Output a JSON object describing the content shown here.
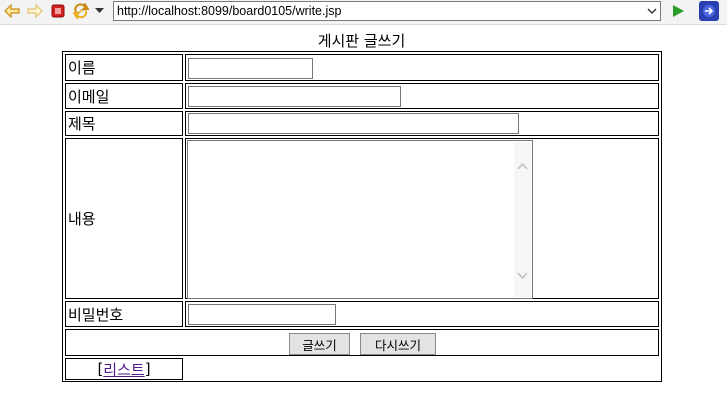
{
  "toolbar": {
    "url": "http://localhost:8099/board0105/write.jsp",
    "icons": [
      "back-arrow-icon",
      "forward-arrow-icon",
      "stop-icon",
      "refresh-icon",
      "history-dropdown-icon",
      "url-dropdown-icon",
      "go-icon",
      "extension-icon"
    ]
  },
  "page": {
    "title": "게시판 글쓰기"
  },
  "form": {
    "name_label": "이름",
    "email_label": "이메일",
    "subject_label": "제목",
    "content_label": "내용",
    "password_label": "비밀번호",
    "submit_label": "글쓰기",
    "reset_label": "다시쓰기",
    "name_value": "",
    "email_value": "",
    "subject_value": "",
    "content_value": "",
    "password_value": ""
  },
  "list_link": {
    "bracket_open": "[",
    "label": "리스트",
    "bracket_close": "]"
  },
  "colors": {
    "toolbar_bg": "#f3f3f3",
    "link": "#551a8b",
    "go_icon": "#2aa02a",
    "stop_icon": "#d02020",
    "nav_icon": "#e8b020"
  }
}
